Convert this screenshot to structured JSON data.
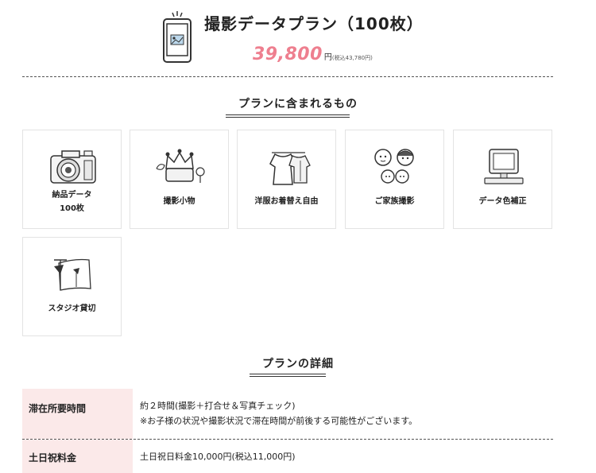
{
  "plan": {
    "title": "撮影データプラン（100枚）",
    "price": "39,800",
    "yen": "円",
    "tax": "(税込43,780円)"
  },
  "included": {
    "heading": "プランに含まれるもの",
    "items": [
      {
        "label_line1": "納品データ",
        "label_line2": "100枚",
        "icon": "camera-icon"
      },
      {
        "label_line1": "撮影小物",
        "label_line2": "",
        "icon": "props-icon"
      },
      {
        "label_line1": "洋服お着替え自由",
        "label_line2": "",
        "icon": "clothes-icon"
      },
      {
        "label_line1": "ご家族撮影",
        "label_line2": "",
        "icon": "family-icon"
      },
      {
        "label_line1": "データ色補正",
        "label_line2": "",
        "icon": "computer-icon"
      },
      {
        "label_line1": "スタジオ貸切",
        "label_line2": "",
        "icon": "studio-icon"
      }
    ]
  },
  "details": {
    "heading": "プランの詳細",
    "rows": [
      {
        "label": "滞在所要時間",
        "line1": "約２時間(撮影＋打合せ＆写真チェック)",
        "line2": "※お子様の状況や撮影状況で滞在時間が前後する可能性がございます。"
      },
      {
        "label": "土日祝料金",
        "line1": "土日祝日料金10,000円(税込11,000円)",
        "line2": ""
      }
    ]
  },
  "colors": {
    "price": "#ee7f8f",
    "highlight": "#f7dc36",
    "table_header_bg": "#fbe9e9"
  }
}
